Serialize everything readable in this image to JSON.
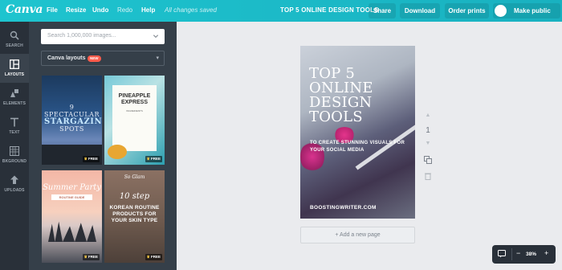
{
  "topbar": {
    "logo": "Canva",
    "menu": [
      "File",
      "Resize",
      "Undo",
      "Redo",
      "Help"
    ],
    "status": "All changes saved",
    "doc_title": "TOP 5 ONLINE DESIGN TOOLS",
    "share": "Share",
    "download": "Download",
    "order": "Order prints",
    "publish": "Make public"
  },
  "rail": [
    {
      "label": "SEARCH",
      "icon": "search-icon"
    },
    {
      "label": "LAYOUTS",
      "icon": "layouts-icon"
    },
    {
      "label": "ELEMENTS",
      "icon": "elements-icon"
    },
    {
      "label": "TEXT",
      "icon": "text-icon"
    },
    {
      "label": "BKGROUND",
      "icon": "background-icon"
    },
    {
      "label": "UPLOADS",
      "icon": "uploads-icon"
    }
  ],
  "panel": {
    "search_placeholder": "Search 1,000,000 images...",
    "dropdown_label": "Canva layouts",
    "badge": "NEW",
    "free_label": "FREE",
    "cards": [
      {
        "line1": "9",
        "line2": "SPECTACULAR",
        "line3": "STARGAZING",
        "line4": "SPOTS"
      },
      {
        "title": "PINEAPPLE EXPRESS",
        "sub": "INGREDIENTS"
      },
      {
        "title": "Summer Party",
        "sub": "ROUTINE GUIDE"
      },
      {
        "script": "So Glam",
        "title": "10 step",
        "body": "KOREAN ROUTINE PRODUCTS FOR YOUR SKIN TYPE"
      }
    ]
  },
  "design": {
    "headline": "TOP 5 ONLINE DESIGN TOOLS",
    "sub": "TO CREATE STUNNING VISUALS FOR YOUR SOCIAL MEDIA",
    "url": "BOOSTINGWRITER.COM"
  },
  "page_tools": {
    "page_number": "1"
  },
  "add_page": "+ Add a new page",
  "zoom": {
    "value": "38%"
  }
}
